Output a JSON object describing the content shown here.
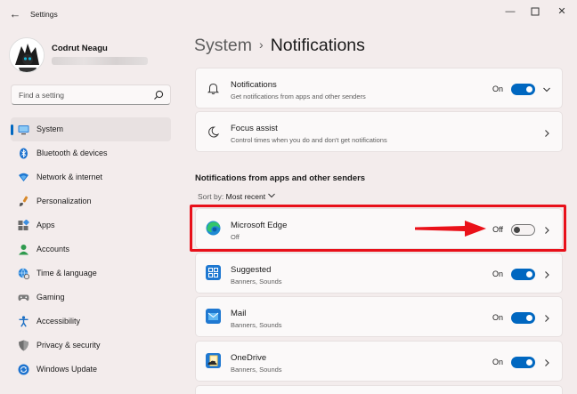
{
  "window": {
    "title": "Settings",
    "minimize_icon": "minimize-icon",
    "maximize_icon": "maximize-icon",
    "close_icon": "close-icon"
  },
  "user": {
    "name": "Codrut Neagu"
  },
  "search": {
    "placeholder": "Find a setting"
  },
  "sidebar": {
    "items": [
      {
        "label": "System",
        "icon": "display-icon",
        "active": true
      },
      {
        "label": "Bluetooth & devices",
        "icon": "bluetooth-icon"
      },
      {
        "label": "Network & internet",
        "icon": "wifi-icon"
      },
      {
        "label": "Personalization",
        "icon": "brush-icon"
      },
      {
        "label": "Apps",
        "icon": "apps-icon"
      },
      {
        "label": "Accounts",
        "icon": "person-icon"
      },
      {
        "label": "Time & language",
        "icon": "globe-clock-icon"
      },
      {
        "label": "Gaming",
        "icon": "gamepad-icon"
      },
      {
        "label": "Accessibility",
        "icon": "accessibility-icon"
      },
      {
        "label": "Privacy & security",
        "icon": "shield-icon"
      },
      {
        "label": "Windows Update",
        "icon": "update-icon"
      }
    ]
  },
  "header": {
    "breadcrumb_parent": "System",
    "separator": "›",
    "title": "Notifications"
  },
  "settings": {
    "notifications": {
      "title": "Notifications",
      "subtitle": "Get notifications from apps and other senders",
      "state": "On"
    },
    "focus_assist": {
      "title": "Focus assist",
      "subtitle": "Control times when you do and don't get notifications"
    }
  },
  "apps_section": {
    "heading": "Notifications from apps and other senders",
    "sort_label": "Sort by:",
    "sort_value": "Most recent",
    "apps": [
      {
        "name": "Microsoft Edge",
        "detail": "Off",
        "state": "Off"
      },
      {
        "name": "Suggested",
        "detail": "Banners, Sounds",
        "state": "On"
      },
      {
        "name": "Mail",
        "detail": "Banners, Sounds",
        "state": "On"
      },
      {
        "name": "OneDrive",
        "detail": "Banners, Sounds",
        "state": "On"
      }
    ]
  },
  "colors": {
    "accent": "#0067c0",
    "annotation": "#e8101a",
    "window_bg": "#f3ecec",
    "card_bg": "#fbf9f9"
  }
}
